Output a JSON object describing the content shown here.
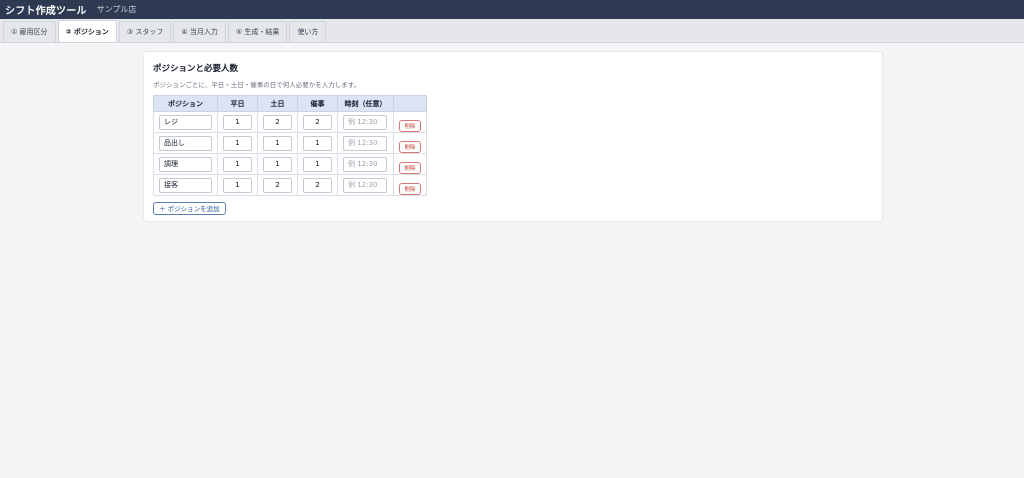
{
  "header": {
    "title": "シフト作成ツール",
    "store": "サンプル店"
  },
  "tabs": [
    {
      "label": "① 雇用区分",
      "active": false
    },
    {
      "label": "② ポジション",
      "active": true
    },
    {
      "label": "③ スタッフ",
      "active": false
    },
    {
      "label": "④ 当月入力",
      "active": false
    },
    {
      "label": "⑤ 生成・結果",
      "active": false
    },
    {
      "label": "使い方",
      "active": false
    }
  ],
  "section": {
    "title": "ポジションと必要人数",
    "description": "ポジションごとに、平日・土日・催事の日で何人必要かを入力します。",
    "columns": [
      "ポジション",
      "平日",
      "土日",
      "催事",
      "時刻（任意）",
      ""
    ],
    "time_placeholder": "例 12:30",
    "delete_label": "削除",
    "rows": [
      {
        "name": "レジ",
        "weekday": "1",
        "weekend": "2",
        "event": "2"
      },
      {
        "name": "品出し",
        "weekday": "1",
        "weekend": "1",
        "event": "1"
      },
      {
        "name": "調理",
        "weekday": "1",
        "weekend": "1",
        "event": "1"
      },
      {
        "name": "接客",
        "weekday": "1",
        "weekend": "2",
        "event": "2"
      }
    ],
    "add_button": "＋ ポジションを追加"
  }
}
